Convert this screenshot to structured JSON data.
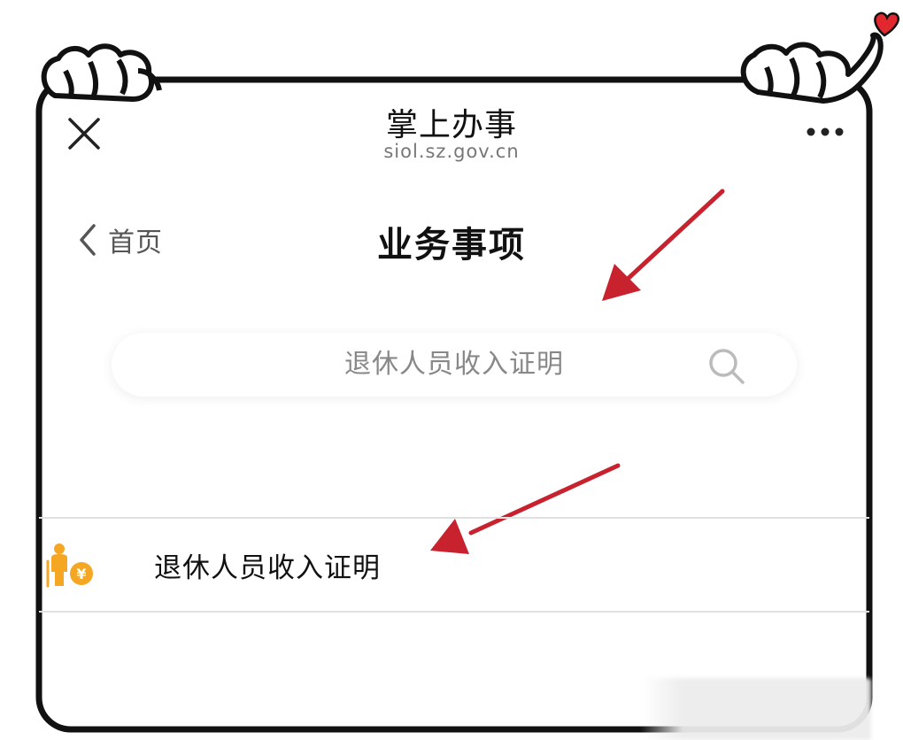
{
  "header": {
    "title": "掌上办事",
    "domain": "siol.sz.gov.cn"
  },
  "nav": {
    "back_label": "首页",
    "page_title": "业务事项"
  },
  "search": {
    "value": "退休人员收入证明"
  },
  "results": [
    {
      "label": "退休人员收入证明",
      "icon": "retiree-income-icon"
    }
  ],
  "icons": {
    "close": "close-icon",
    "more": "more-icon",
    "back": "chevron-left-icon",
    "search": "search-icon"
  },
  "colors": {
    "frame": "#111111",
    "arrow": "#c8222e",
    "heart": "#e0282e",
    "icon_orange": "#f5a623"
  }
}
